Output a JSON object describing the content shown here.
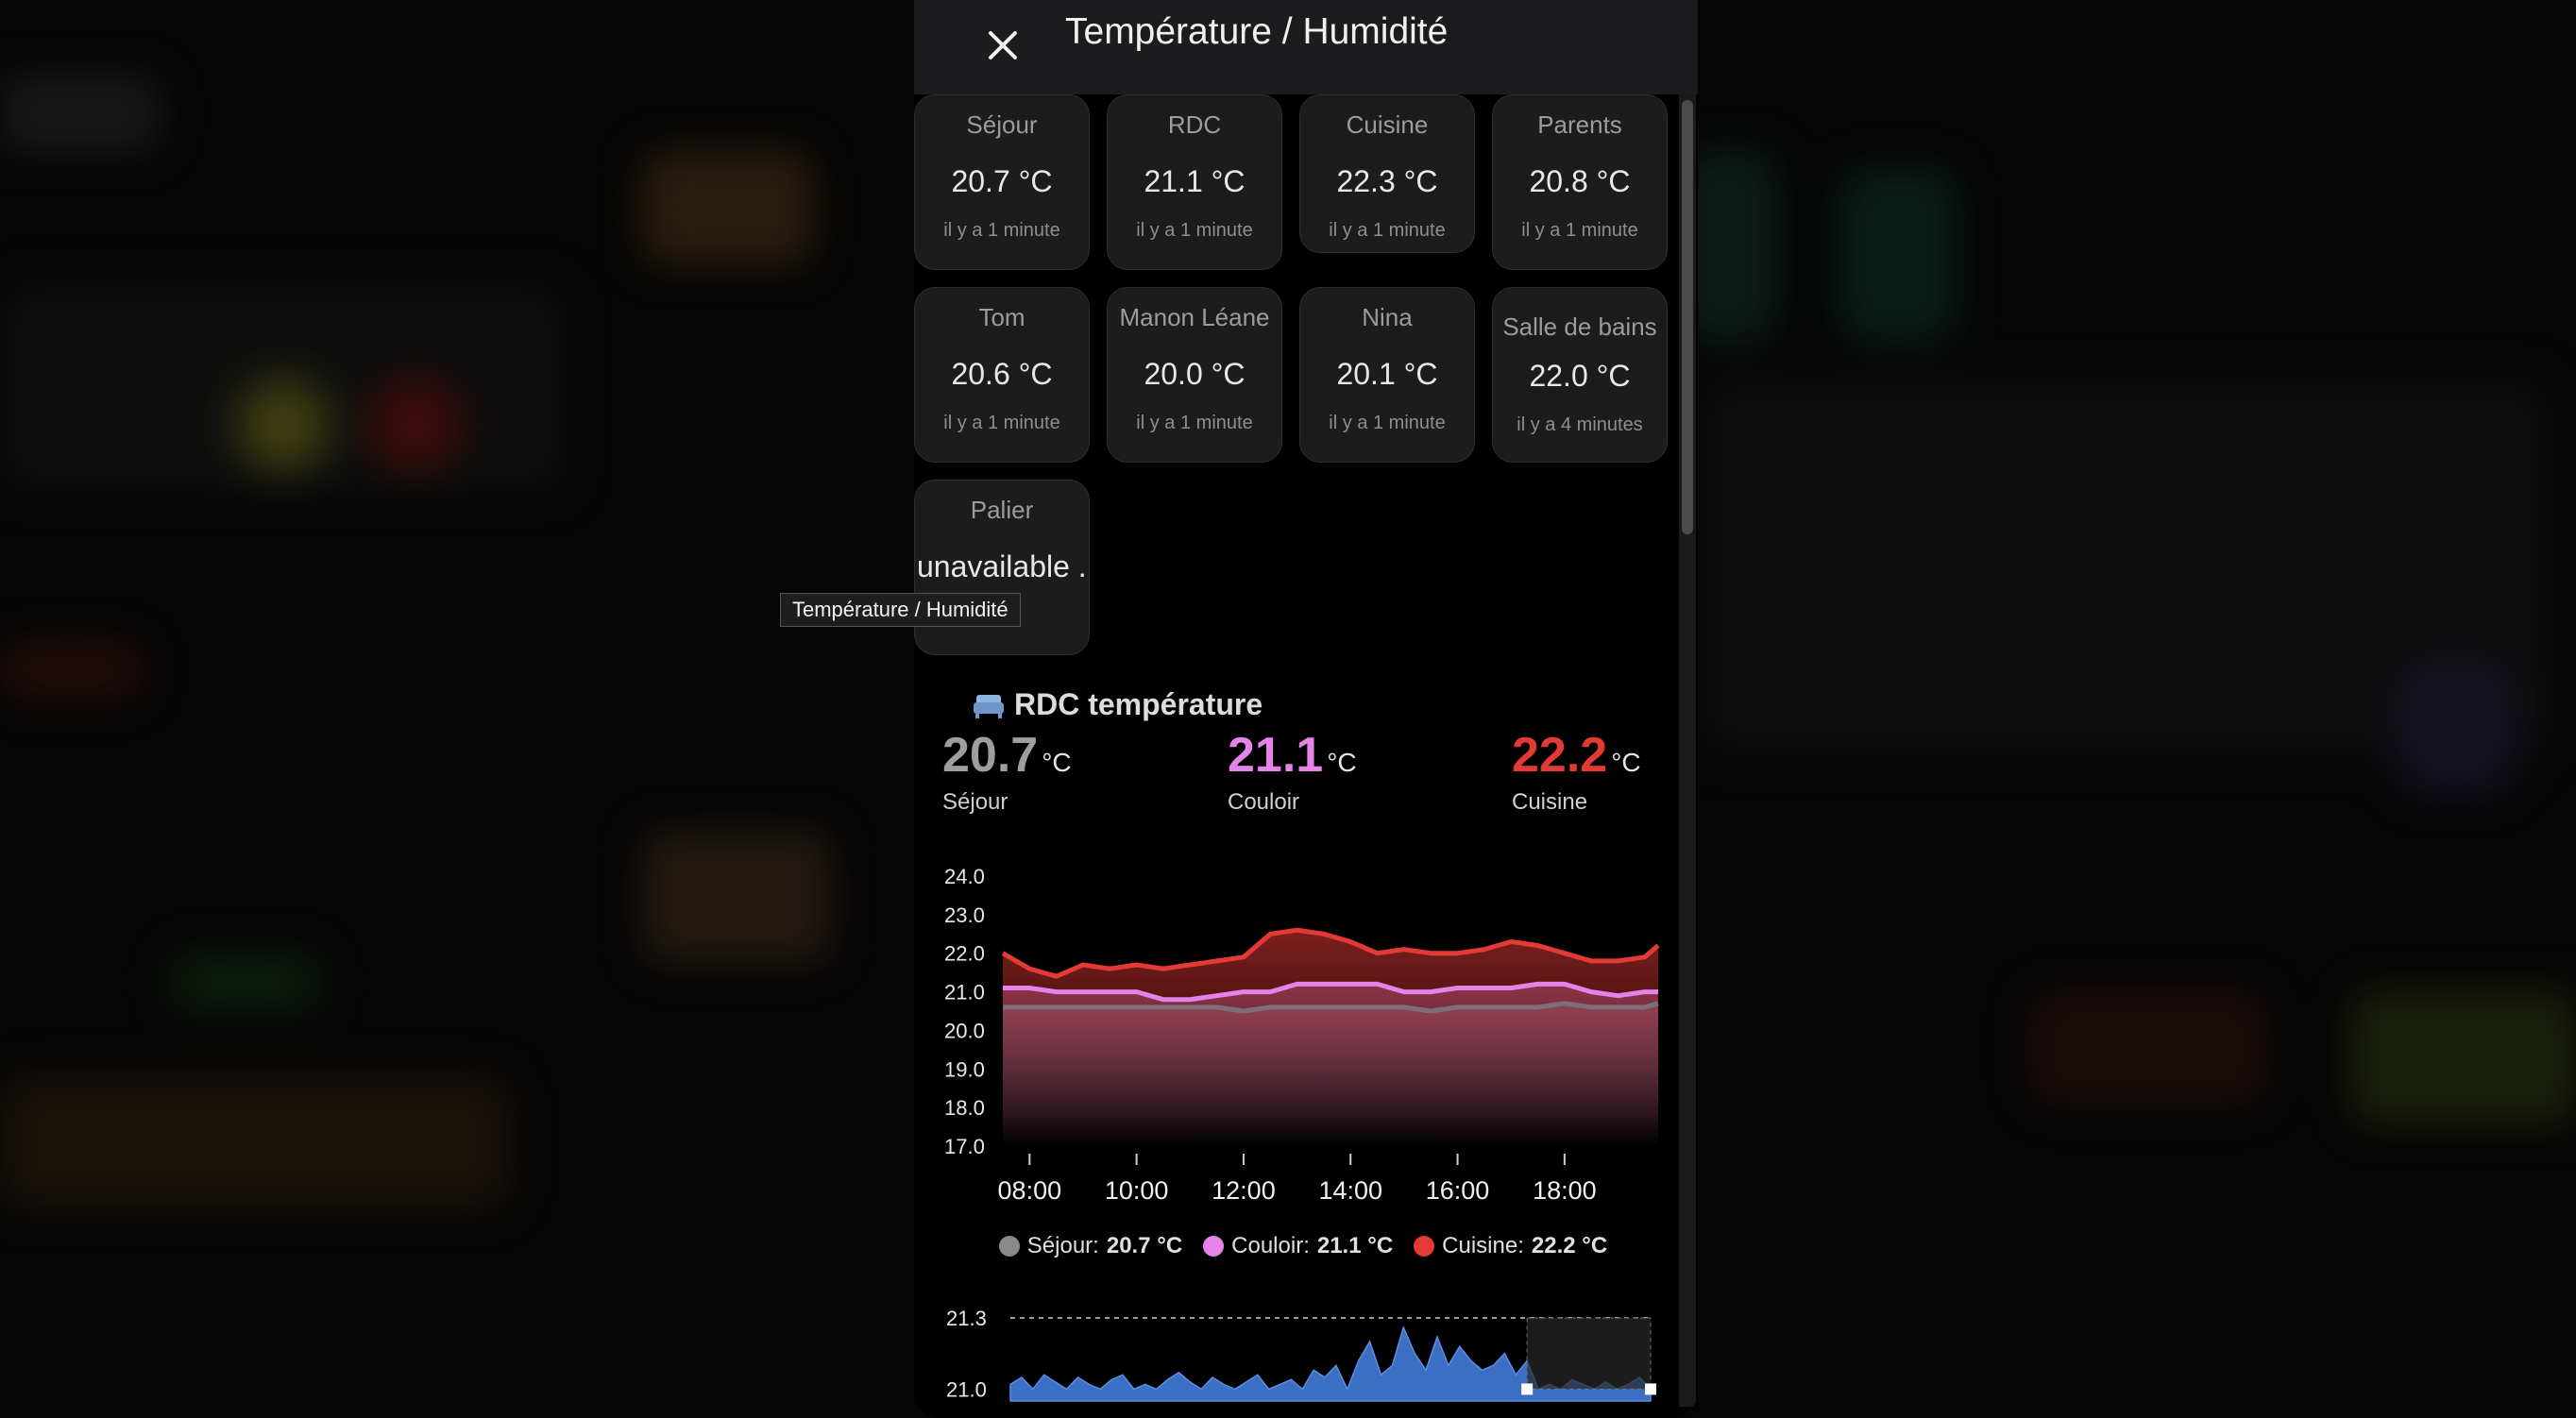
{
  "dialog": {
    "title": "Température / Humidité",
    "tooltip": "Température / Humidité"
  },
  "tiles": [
    {
      "name": "Séjour",
      "value": "20.7 °C",
      "time": "il y a 1 minute"
    },
    {
      "name": "RDC",
      "value": "21.1 °C",
      "time": "il y a 1 minute"
    },
    {
      "name": "Cuisine",
      "value": "22.3 °C",
      "time": "il y a 1 minute"
    },
    {
      "name": "Parents",
      "value": "20.8 °C",
      "time": "il y a 1 minute"
    },
    {
      "name": "Tom",
      "value": "20.6 °C",
      "time": "il y a 1 minute"
    },
    {
      "name": "Manon Léane",
      "value": "20.0 °C",
      "time": "il y a 1 minute"
    },
    {
      "name": "Nina",
      "value": "20.1 °C",
      "time": "il y a 1 minute"
    },
    {
      "name": "Salle de bains",
      "value": "22.0 °C",
      "time": "il y a 4 minutes"
    },
    {
      "name": "Palier",
      "value": "unavailable ...",
      "time": ""
    }
  ],
  "card": {
    "title": "RDC température",
    "icon": "sofa-icon",
    "unit": "°C",
    "sensors": [
      {
        "value": "20.7",
        "label": "Séjour",
        "color": "#9e9e9e"
      },
      {
        "value": "21.1",
        "label": "Couloir",
        "color": "#e583e8"
      },
      {
        "value": "22.2",
        "label": "Cuisine",
        "color": "#e43a36"
      }
    ]
  },
  "legend": [
    {
      "label": "Séjour:",
      "value": "20.7 °C",
      "color": "#8a8a8a"
    },
    {
      "label": "Couloir:",
      "value": "21.1 °C",
      "color": "#e583e8"
    },
    {
      "label": "Cuisine:",
      "value": "22.2 °C",
      "color": "#e43a36"
    }
  ],
  "chart_data": [
    {
      "type": "area",
      "ylim": [
        17.0,
        24.0
      ],
      "yticks": [
        "24.0",
        "23.0",
        "22.0",
        "21.0",
        "20.0",
        "19.0",
        "18.0",
        "17.0"
      ],
      "xticks": [
        "08:00",
        "10:00",
        "12:00",
        "14:00",
        "16:00",
        "18:00"
      ],
      "x": [
        "07:30",
        "08:00",
        "08:30",
        "09:00",
        "09:30",
        "10:00",
        "10:30",
        "11:00",
        "11:30",
        "12:00",
        "12:30",
        "13:00",
        "13:30",
        "14:00",
        "14:30",
        "15:00",
        "15:30",
        "16:00",
        "16:30",
        "17:00",
        "17:30",
        "18:00",
        "18:30",
        "19:00",
        "19:30",
        "19:45"
      ],
      "series": [
        {
          "name": "Séjour",
          "color": "#7d6f76",
          "values": [
            20.6,
            20.6,
            20.6,
            20.6,
            20.6,
            20.6,
            20.6,
            20.6,
            20.6,
            20.5,
            20.6,
            20.6,
            20.6,
            20.6,
            20.6,
            20.6,
            20.5,
            20.6,
            20.6,
            20.6,
            20.6,
            20.7,
            20.6,
            20.6,
            20.6,
            20.7
          ]
        },
        {
          "name": "Couloir",
          "color": "#e583e8",
          "values": [
            21.1,
            21.1,
            21.0,
            21.0,
            21.0,
            21.0,
            20.8,
            20.8,
            20.9,
            21.0,
            21.0,
            21.2,
            21.2,
            21.2,
            21.2,
            21.0,
            21.0,
            21.1,
            21.1,
            21.1,
            21.2,
            21.2,
            21.0,
            20.9,
            21.0,
            21.0
          ]
        },
        {
          "name": "Cuisine",
          "color": "#e43a36",
          "values": [
            22.0,
            21.6,
            21.4,
            21.7,
            21.6,
            21.7,
            21.6,
            21.7,
            21.8,
            21.9,
            22.5,
            22.6,
            22.5,
            22.3,
            22.0,
            22.1,
            22.0,
            22.0,
            22.1,
            22.3,
            22.2,
            22.0,
            21.8,
            21.8,
            21.9,
            22.2
          ]
        }
      ]
    },
    {
      "type": "area",
      "ylim": [
        20.95,
        21.3
      ],
      "yticks": [
        "21.3",
        "21.0"
      ],
      "x": [
        "07:30",
        "19:45"
      ],
      "series": [
        {
          "name": "RDC",
          "color": "#3a6fc4",
          "values": [
            21.02,
            21.05,
            21.0,
            21.06,
            21.03,
            21.0,
            21.05,
            21.02,
            21.0,
            21.04,
            21.06,
            21.0,
            21.02,
            21.0,
            21.04,
            21.07,
            21.03,
            21.0,
            21.05,
            21.02,
            21.0,
            21.03,
            21.06,
            21.0,
            21.02,
            21.04,
            21.0,
            21.08,
            21.05,
            21.1,
            21.0,
            21.12,
            21.2,
            21.06,
            21.1,
            21.26,
            21.15,
            21.08,
            21.22,
            21.1,
            21.18,
            21.12,
            21.08,
            21.1,
            21.15,
            21.06,
            21.12,
            21.0,
            21.02,
            21.0,
            21.04,
            21.02,
            21.0,
            21.03,
            21.0,
            21.02,
            21.05,
            21.0
          ]
        }
      ]
    }
  ]
}
